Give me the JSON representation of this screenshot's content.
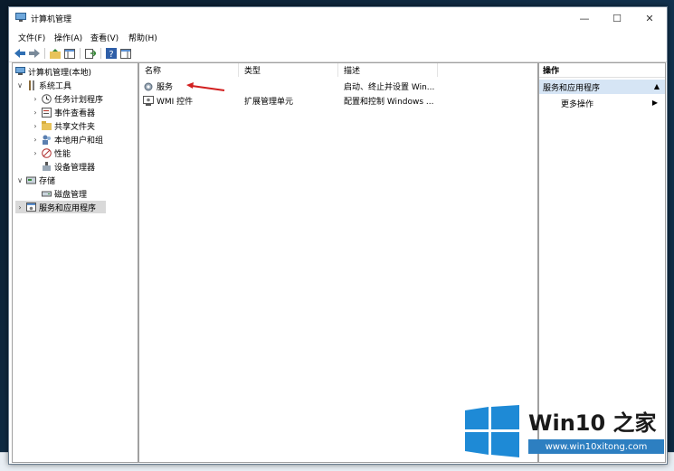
{
  "window": {
    "title": "计算机管理"
  },
  "menu": {
    "file": "文件(F)",
    "action": "操作(A)",
    "view": "查看(V)",
    "help": "帮助(H)"
  },
  "tree": {
    "root": "计算机管理(本地)",
    "system_tools": "系统工具",
    "task_scheduler": "任务计划程序",
    "event_viewer": "事件查看器",
    "shared_folders": "共享文件夹",
    "local_users": "本地用户和组",
    "performance": "性能",
    "device_manager": "设备管理器",
    "storage": "存储",
    "disk_management": "磁盘管理",
    "services_apps": "服务和应用程序"
  },
  "list": {
    "columns": {
      "name": "名称",
      "type": "类型",
      "desc": "描述"
    },
    "rows": [
      {
        "name": "服务",
        "type": "",
        "desc": "启动、终止并设置 Win..."
      },
      {
        "name": "WMI 控件",
        "type": "扩展管理单元",
        "desc": "配置和控制 Windows ..."
      }
    ]
  },
  "actions": {
    "header": "操作",
    "section": "服务和应用程序",
    "more": "更多操作"
  },
  "watermark": {
    "title": "Win10 之家",
    "url": "www.win10xitong.com"
  },
  "colors": {
    "accent": "#d6e5f5",
    "arrow": "#d21f1f",
    "brand": "#2d7fc1"
  }
}
